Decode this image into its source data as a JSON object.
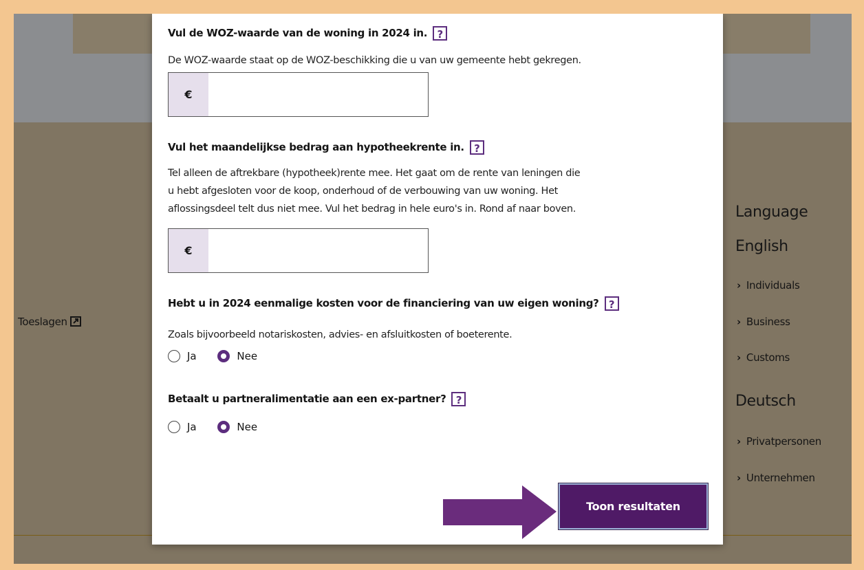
{
  "background_page": {
    "toeslagen_link": "Toeslagen",
    "language_heading": "Language",
    "english_heading": "English",
    "english_links": [
      "Individuals",
      "Business",
      "Customs"
    ],
    "german_heading": "Deutsch",
    "german_links": [
      "Privatpersonen",
      "Unternehmen"
    ]
  },
  "modal": {
    "woz": {
      "title": "Vul de WOZ-waarde van de woning in 2024 in.",
      "help": "?",
      "description": "De WOZ-waarde staat op de WOZ-beschikking die u van uw gemeente hebt gekregen.",
      "currency": "€",
      "value": ""
    },
    "hypotheekrente": {
      "title": "Vul het maandelijkse bedrag aan hypotheekrente in.",
      "help": "?",
      "description_lines": [
        "Tel alleen de aftrekbare (hypotheek)rente mee. Het gaat om de rente van leningen die",
        "u hebt afgesloten voor de koop, onderhoud of de verbouwing van uw woning. Het",
        "aflossingsdeel telt dus niet mee. Vul het bedrag in hele euro's in. Rond af naar boven."
      ],
      "currency": "€",
      "value": ""
    },
    "financiering": {
      "title": "Hebt u in 2024 eenmalige kosten voor de financiering van uw eigen woning?",
      "help": "?",
      "description": "Zoals bijvoorbeeld notariskosten, advies- en afsluitkosten of boeterente.",
      "options": [
        "Ja",
        "Nee"
      ],
      "selected": "Nee"
    },
    "partneralimentatie": {
      "title": "Betaalt u partneralimentatie aan een ex-partner?",
      "help": "?",
      "options": [
        "Ja",
        "Nee"
      ],
      "selected": "Nee"
    },
    "submit_label": "Toon resultaten"
  },
  "colors": {
    "accent_purple": "#5c2d7e",
    "button_bg": "#4f1a66",
    "annotation_arrow": "#6a2c7c",
    "frame_border": "#f3c690"
  }
}
